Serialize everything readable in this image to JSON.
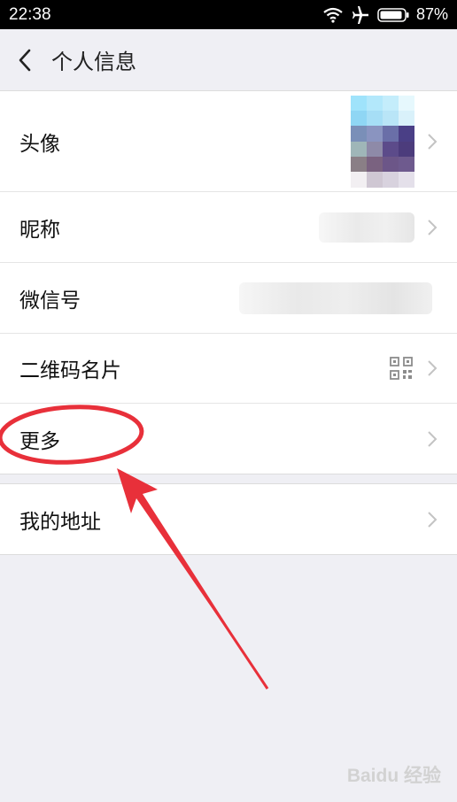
{
  "status_bar": {
    "time": "22:38",
    "battery": "87%"
  },
  "nav": {
    "title": "个人信息"
  },
  "rows": {
    "avatar": "头像",
    "nickname": "昵称",
    "wechat_id": "微信号",
    "qr_card": "二维码名片",
    "more": "更多",
    "address": "我的地址"
  },
  "annotation_color": "#e8303a",
  "watermark": "Baidu 经验"
}
